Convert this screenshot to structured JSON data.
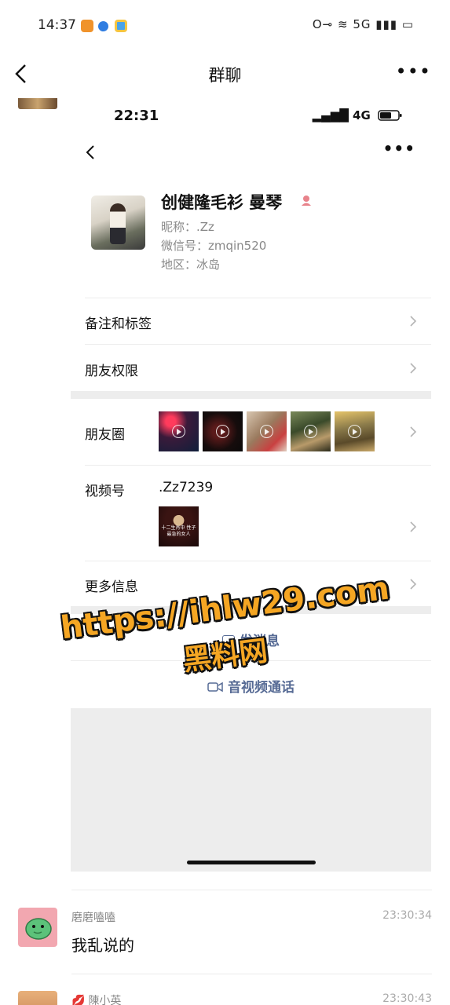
{
  "status_bar": {
    "time": "14:37",
    "right": "O⊸ ≋ 5G ▮▮▮ ▭"
  },
  "nav": {
    "title": "群聊"
  },
  "inner": {
    "time": "22:31",
    "signal": "▂▄▆█ 4G",
    "profile": {
      "name": "创健隆毛衫 曼琴",
      "gender_icon": "female-icon",
      "nickname": "昵称：.Zz",
      "wechat_id": "微信号：zmqin520",
      "region": "地区：冰岛"
    },
    "rows": {
      "remarks": "备注和标签",
      "permissions": "朋友权限",
      "moments": "朋友圈",
      "channels": "视频号",
      "channels_id": ".Zz7239",
      "channels_thumb_text": "十二生肖中 性子最急的女人",
      "more_info": "更多信息"
    },
    "actions": {
      "send_message": "发消息",
      "av_call": "音视频通话"
    },
    "colors": {
      "link": "#576b95",
      "separator": "#ededed"
    }
  },
  "watermark": {
    "line1": "https://ihlw29.com",
    "line2": "黑料网"
  },
  "messages": [
    {
      "name": "磨磨嗑嗑",
      "time": "23:30:34",
      "text": "我乱说的"
    },
    {
      "name": "陳小英",
      "time": "23:30:43",
      "text": ""
    }
  ]
}
